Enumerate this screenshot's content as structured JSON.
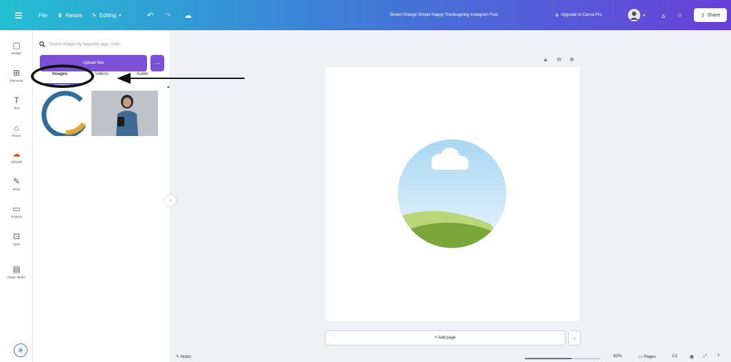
{
  "topbar": {
    "menu_icon": "hamburger-icon",
    "file_label": "File",
    "resize_label": "Resize",
    "editing_label": "Editing",
    "title": "Brown Orange Simple Happy Thanksgiving Instagram Post",
    "upgrade_label": "Upgrade to Canva Pro",
    "share_label": "Share"
  },
  "sidebar": {
    "items": [
      {
        "label": "Design",
        "icon": "design-icon"
      },
      {
        "label": "Elements",
        "icon": "elements-icon"
      },
      {
        "label": "Text",
        "icon": "text-icon"
      },
      {
        "label": "Brand",
        "icon": "brand-icon"
      },
      {
        "label": "Uploads",
        "icon": "uploads-icon"
      },
      {
        "label": "Draw",
        "icon": "draw-icon"
      },
      {
        "label": "Projects",
        "icon": "projects-icon"
      },
      {
        "label": "Apps",
        "icon": "apps-icon"
      },
      {
        "label": "Magic Media",
        "icon": "magic-media-icon"
      }
    ]
  },
  "panel": {
    "search_placeholder": "Search images by keyword, tags, color...",
    "upload_label": "Upload files",
    "more_label": "···",
    "tabs": [
      {
        "label": "Images"
      },
      {
        "label": "Videos"
      },
      {
        "label": "Audio"
      }
    ]
  },
  "canvas": {
    "add_page_label": "+ Add page"
  },
  "bottom": {
    "notes_label": "Notes",
    "zoom_label": "62%",
    "zoom_value": 0.62,
    "pages_label": "Pages",
    "page_count": "1/1"
  },
  "colors": {
    "accent": "#7b4fd6",
    "topbar_start": "#24bfd2",
    "topbar_end": "#6a3fd8"
  }
}
